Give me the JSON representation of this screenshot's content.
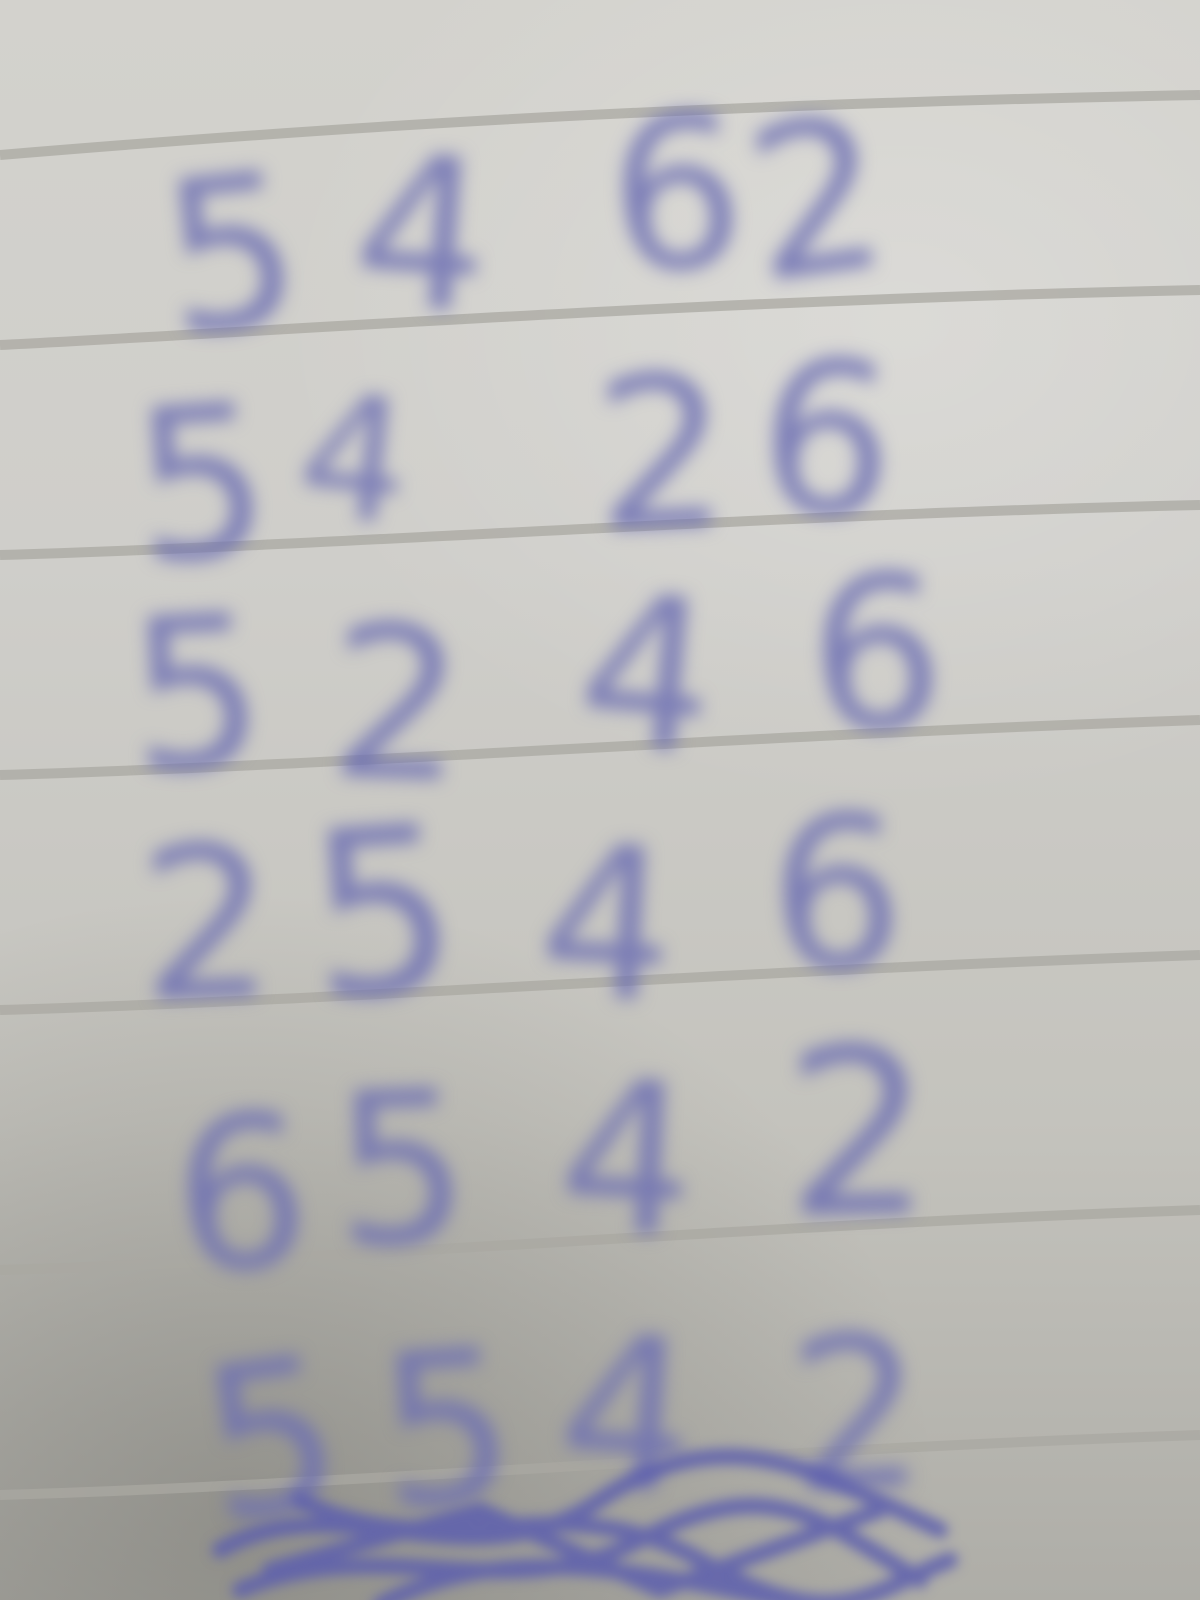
{
  "photo": {
    "subject": "handwritten digits on lined paper",
    "rows": [
      {
        "digits": [
          "5",
          "4",
          "6",
          "2"
        ]
      },
      {
        "digits": [
          "5",
          "4",
          "2",
          "6"
        ]
      },
      {
        "digits": [
          "5",
          "2",
          "4",
          "6"
        ]
      },
      {
        "digits": [
          "2",
          "5",
          "4",
          "6"
        ]
      },
      {
        "digits": [
          "6",
          "5",
          "4",
          "2"
        ]
      },
      {
        "digits": [
          "5",
          "5",
          "4",
          "2"
        ]
      }
    ],
    "ink_color": "#6d6fb3",
    "paper_color": "#cfceca",
    "line_color": "#a9a8a2"
  }
}
